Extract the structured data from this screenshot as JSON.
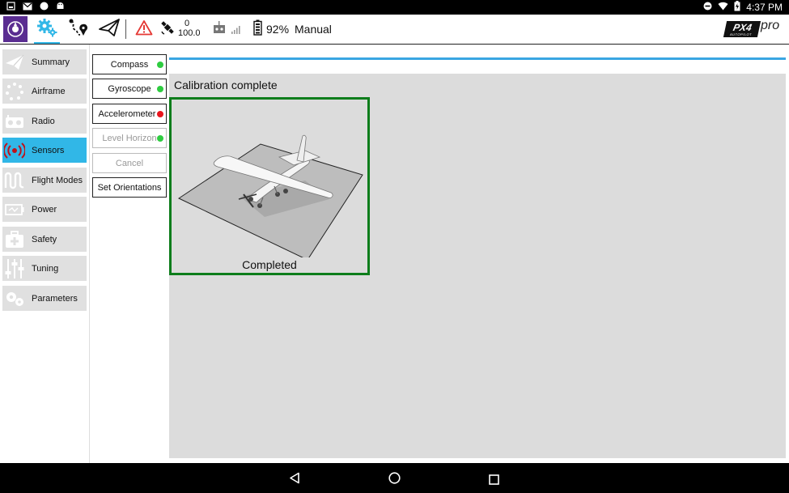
{
  "status_bar": {
    "time": "4:37 PM",
    "left_icons": [
      "screenshot-icon",
      "gmail-icon",
      "circle-icon",
      "android-icon"
    ],
    "right_icons": [
      "do-not-disturb-icon",
      "wifi-icon",
      "battery-charging-icon"
    ]
  },
  "toolbar": {
    "gps_count": "0",
    "gps_hdop": "100.0",
    "battery_percent": "92%",
    "flight_mode": "Manual",
    "logo_text": "PX4",
    "logo_sub": "AUTOPILOT",
    "logo_suffix": "pro"
  },
  "left_nav": {
    "items": [
      {
        "label": "Summary",
        "icon": "paper-plane-icon"
      },
      {
        "label": "Airframe",
        "icon": "airframe-icon"
      },
      {
        "label": "Radio",
        "icon": "radio-icon"
      },
      {
        "label": "Sensors",
        "icon": "sensors-icon",
        "active": true
      },
      {
        "label": "Flight Modes",
        "icon": "flight-modes-icon"
      },
      {
        "label": "Power",
        "icon": "power-icon"
      },
      {
        "label": "Safety",
        "icon": "safety-icon"
      },
      {
        "label": "Tuning",
        "icon": "tuning-icon"
      },
      {
        "label": "Parameters",
        "icon": "parameters-icon"
      }
    ]
  },
  "sensor_buttons": [
    {
      "label": "Compass",
      "status": "green"
    },
    {
      "label": "Gyroscope",
      "status": "green"
    },
    {
      "label": "Accelerometer",
      "status": "red"
    },
    {
      "label": "Level Horizon",
      "status": "green",
      "disabled": true
    },
    {
      "label": "Cancel",
      "disabled": true
    },
    {
      "label": "Set Orientations"
    }
  ],
  "calibration": {
    "title": "Calibration complete",
    "status": "Completed"
  },
  "colors": {
    "accent_blue": "#31b7e7",
    "progress_blue": "#3aa6e2",
    "ok_green": "#2ecc40",
    "error_red": "#e8141c",
    "box_green": "#0d7d1b",
    "warning_red": "#e53935"
  }
}
